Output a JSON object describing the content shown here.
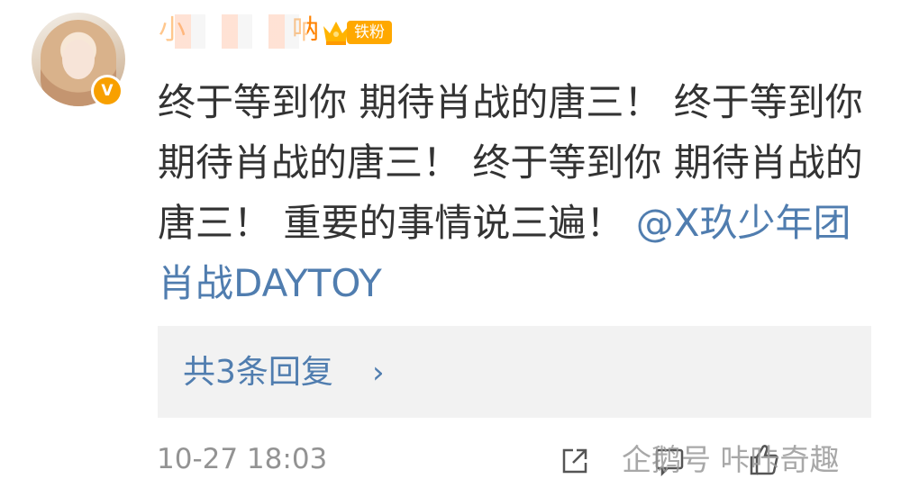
{
  "comment": {
    "username_partial": "小",
    "username_tail": "呐",
    "fan_badge": "铁粉",
    "content_text": "终于等到你 期待肖战的唐三！    终于等到你 期待肖战的唐三！    终于等到你 期待肖战的唐三！    重要的事情说三遍！ ",
    "mention": "@X玖少年团肖战DAYTOY",
    "reply_link": "共3条回复",
    "timestamp": "10-27 18:03"
  },
  "watermark": {
    "text": "企鹅号 咔咔奇趣"
  },
  "icons": {
    "badge": "verified-v-icon",
    "crown": "crown-icon",
    "share": "share-icon",
    "comment": "comment-icon",
    "like": "like-icon",
    "reply_arrow": "chevron-right-icon"
  },
  "colors": {
    "username": "#ff8200",
    "fan_badge": "#ffa800",
    "mention": "#507daf",
    "reply_bg": "#f2f2f2",
    "timestamp": "#939393",
    "text": "#333333"
  }
}
